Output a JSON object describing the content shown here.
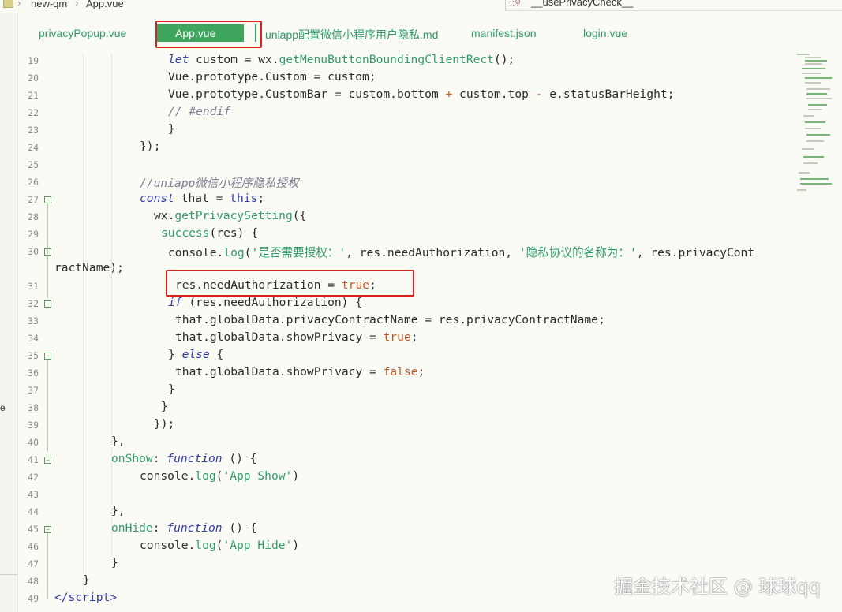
{
  "breadcrumb": {
    "project": "new-qm",
    "file": "App.vue"
  },
  "find": {
    "query": "__usePrivacyCheck__"
  },
  "tabs": [
    {
      "label": "privacyPopup.vue"
    },
    {
      "label": "App.vue"
    },
    {
      "label": "uniapp配置微信小程序用户隐私.md"
    },
    {
      "label": "manifest.json"
    },
    {
      "label": "login.vue"
    }
  ],
  "left_fragment": "e",
  "line_numbers": [
    "19",
    "20",
    "21",
    "22",
    "23",
    "24",
    "25",
    "26",
    "27",
    "28",
    "29",
    "30",
    "31",
    "32",
    "33",
    "34",
    "35",
    "36",
    "37",
    "38",
    "39",
    "40",
    "41",
    "42",
    "43",
    "44",
    "45",
    "46",
    "47",
    "48",
    "49"
  ],
  "code": {
    "l19_kw": "let",
    "l19_a": " custom = wx.",
    "l19_fn": "getMenuButtonBoundingClientRect",
    "l19_b": "();",
    "l20": "Vue.prototype.Custom = custom;",
    "l21_a": "Vue.prototype.CustomBar = custom.bottom ",
    "l21_op1": "+",
    "l21_b": " custom.top ",
    "l21_op2": "-",
    "l21_c": " e.statusBarHeight;",
    "l22": "// #endif",
    "l23": "}",
    "l24": "});",
    "l26": "//uniapp微信小程序隐私授权",
    "l27_kw": "const",
    "l27_a": " that = ",
    "l27_kw2": "this",
    "l27_b": ";",
    "l28_a": "wx.",
    "l28_fn": "getPrivacySetting",
    "l28_b": "({",
    "l29_fn": "success",
    "l29_b": "(res) {",
    "l30_a": "console.",
    "l30_fn": "log",
    "l30_b": "(",
    "l30_str1": "'是否需要授权：'",
    "l30_c": ", res.needAuthorization, ",
    "l30_str2": "'隐私协议的名称为：'",
    "l30_d": ", res.privacyCont",
    "l30_wrap": "ractName);",
    "l31_a": "res.needAuthorization = ",
    "l31_kw": "true",
    "l31_b": ";",
    "l32_kw": "if",
    "l32_a": " (res.needAuthorization) {",
    "l33": "that.globalData.privacyContractName = res.privacyContractName;",
    "l34_a": "that.globalData.showPrivacy = ",
    "l34_kw": "true",
    "l34_b": ";",
    "l35_a": "} ",
    "l35_kw": "else",
    "l35_b": " {",
    "l36_a": "that.globalData.showPrivacy = ",
    "l36_kw": "false",
    "l36_b": ";",
    "l37": "}",
    "l38": "}",
    "l39": "});",
    "l40": "},",
    "l41_fn": "onShow",
    "l41_a": ": ",
    "l41_kw": "function",
    "l41_b": " () {",
    "l42_a": "console.",
    "l42_fn": "log",
    "l42_b": "(",
    "l42_str": "'App Show'",
    "l42_c": ")",
    "l44": "},",
    "l45_fn": "onHide",
    "l45_a": ": ",
    "l45_kw": "function",
    "l45_b": " () {",
    "l46_a": "console.",
    "l46_fn": "log",
    "l46_b": "(",
    "l46_str": "'App Hide'",
    "l46_c": ")",
    "l47": "}",
    "l48": "}",
    "l49_a": "</",
    "l49_tag": "script",
    "l49_b": ">"
  },
  "watermark": "掘金技术社区 @ 球球qq",
  "colors": {
    "active_tab": "#3ea65c",
    "highlight_box": "#e02020",
    "keyword": "#2f39a8",
    "string": "#2e9c67"
  }
}
